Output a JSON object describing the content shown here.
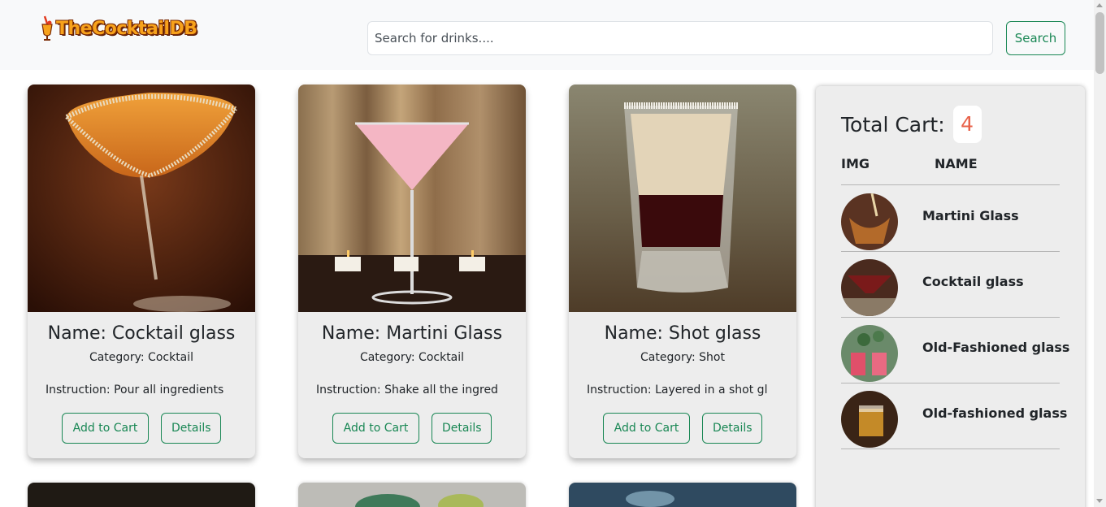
{
  "navbar": {
    "logo_text": "TheCocktailDB",
    "search": {
      "placeholder": "Search for drinks....",
      "value": ""
    },
    "search_button": "Search"
  },
  "cards": [
    {
      "name": "Name: Cocktail glass",
      "category": "Category: Cocktail",
      "instruction": "Instruction: Pour all ingredients",
      "add_label": "Add to Cart",
      "details_label": "Details"
    },
    {
      "name": "Name: Martini Glass",
      "category": "Category: Cocktail",
      "instruction": "Instruction: Shake all the ingred",
      "add_label": "Add to Cart",
      "details_label": "Details"
    },
    {
      "name": "Name: Shot glass",
      "category": "Category: Shot",
      "instruction": "Instruction: Layered in a shot gl",
      "add_label": "Add to Cart",
      "details_label": "Details"
    }
  ],
  "cart": {
    "title": "Total Cart:",
    "count": "4",
    "col_img": "IMG",
    "col_name": "NAME",
    "items": [
      {
        "name": "Martini Glass"
      },
      {
        "name": "Cocktail glass"
      },
      {
        "name": "Old-Fashioned glass"
      },
      {
        "name": "Old-fashioned glass"
      }
    ]
  },
  "colors": {
    "accent": "#198754",
    "cart_count": "#e8624a",
    "card_bg": "#ededed",
    "navbar_bg": "#f8f9fa"
  }
}
